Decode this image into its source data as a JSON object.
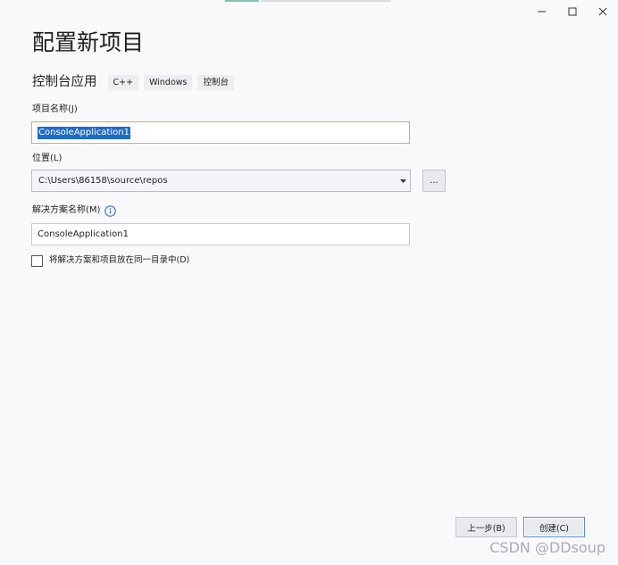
{
  "window": {
    "minimize_icon": "minimize-icon",
    "maximize_icon": "maximize-icon",
    "close_icon": "close-icon"
  },
  "page": {
    "title": "配置新项目"
  },
  "template": {
    "name": "控制台应用",
    "tags": [
      "C++",
      "Windows",
      "控制台"
    ]
  },
  "project_name": {
    "label": "项目名称(J)",
    "value": "ConsoleApplication1"
  },
  "location": {
    "label": "位置(L)",
    "value": "C:\\Users\\86158\\source\\repos",
    "browse_label": "..."
  },
  "solution_name": {
    "label": "解决方案名称(M)",
    "value": "ConsoleApplication1",
    "info_icon": "info-icon"
  },
  "same_directory": {
    "label": "将解决方案和项目放在同一目录中(D)",
    "checked": false
  },
  "footer": {
    "back_label": "上一步(B)",
    "create_label": "创建(C)"
  },
  "watermark": "CSDN @DDsoup",
  "colors": {
    "background": "#f9f9fb",
    "focus_border": "#e2a765",
    "selection": "#1e6bc9",
    "info_blue": "#2f6fd1"
  }
}
